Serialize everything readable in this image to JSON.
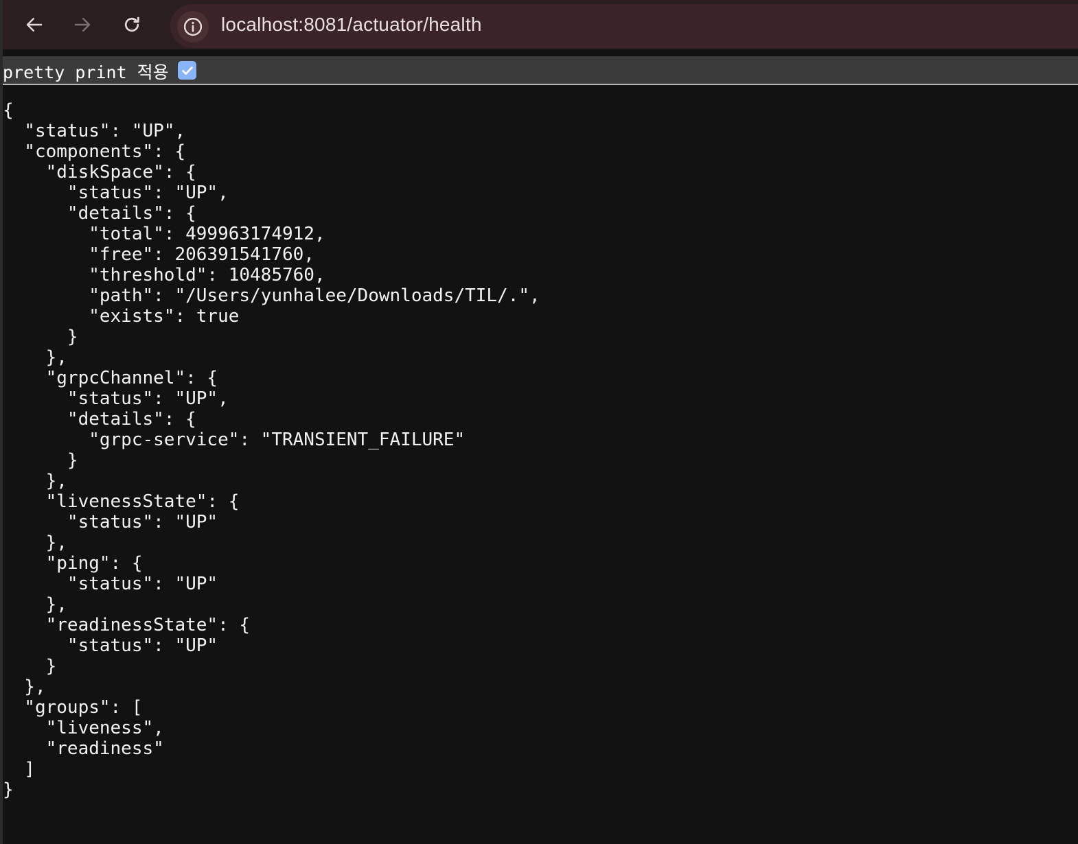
{
  "browser": {
    "url": "localhost:8081/actuator/health",
    "icons": {
      "back": "arrow-left-icon",
      "forward": "arrow-right-icon",
      "reload": "reload-icon",
      "site_info": "info-circle-icon"
    }
  },
  "pretty_print": {
    "label": "pretty print 적용",
    "checked": true
  },
  "json_lines": [
    "{",
    "  \"status\": \"UP\",",
    "  \"components\": {",
    "    \"diskSpace\": {",
    "      \"status\": \"UP\",",
    "      \"details\": {",
    "        \"total\": 499963174912,",
    "        \"free\": 206391541760,",
    "        \"threshold\": 10485760,",
    "        \"path\": \"/Users/yunhalee/Downloads/TIL/.\",",
    "        \"exists\": true",
    "      }",
    "    },",
    "    \"grpcChannel\": {",
    "      \"status\": \"UP\",",
    "      \"details\": {",
    "        \"grpc-service\": \"TRANSIENT_FAILURE\"",
    "      }",
    "    },",
    "    \"livenessState\": {",
    "      \"status\": \"UP\"",
    "    },",
    "    \"ping\": {",
    "      \"status\": \"UP\"",
    "    },",
    "    \"readinessState\": {",
    "      \"status\": \"UP\"",
    "    }",
    "  },",
    "  \"groups\": [",
    "    \"liveness\",",
    "    \"readiness\"",
    "  ]",
    "}"
  ],
  "colors": {
    "toolbar_bg": "#2a1e20",
    "omnibox_bg": "#3a2428",
    "page_bg": "#121212",
    "checkbox_accent": "#8ab4f8"
  }
}
